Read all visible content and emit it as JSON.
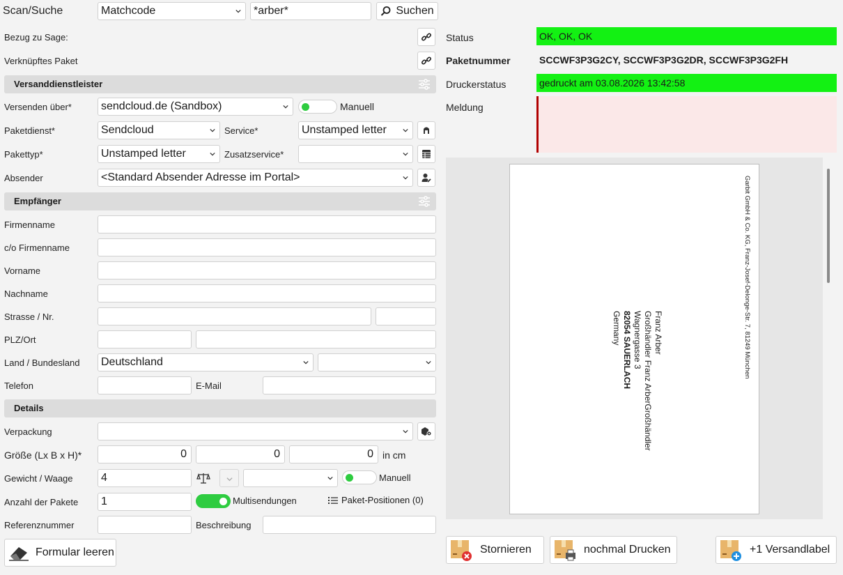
{
  "scan": {
    "label": "Scan/Suche",
    "mode": "Matchcode",
    "query": "*arber*",
    "search_button": "Suchen"
  },
  "refs": {
    "sage_label": "Bezug zu Sage:",
    "paket_label": "Verknüpftes Paket"
  },
  "versand": {
    "section_title": "Versanddienstleister",
    "versenden_label": "Versenden über*",
    "versenden_value": "sendcloud.de (Sandbox)",
    "manuell_label": "Manuell",
    "paketdienst_label": "Paketdienst*",
    "paketdienst_value": "Sendcloud",
    "service_label": "Service*",
    "service_value": "Unstamped letter",
    "pakettyp_label": "Pakettyp*",
    "pakettyp_value": "Unstamped letter",
    "zusatz_label": "Zusatzservice*",
    "zusatz_value": "",
    "absender_label": "Absender",
    "absender_value": "<Standard Absender Adresse im Portal>"
  },
  "empfaenger": {
    "section_title": "Empfänger",
    "firmenname_label": "Firmenname",
    "co_label": "c/o Firmenname",
    "vorname_label": "Vorname",
    "nachname_label": "Nachname",
    "strasse_label": "Strasse / Nr.",
    "plz_label": "PLZ/Ort",
    "land_label": "Land / Bundesland",
    "land_value": "Deutschland",
    "bundesland_value": "",
    "telefon_label": "Telefon",
    "email_label": "E-Mail"
  },
  "details": {
    "section_title": "Details",
    "verpackung_label": "Verpackung",
    "groesse_label": "Größe (Lx B x H)*",
    "l": "0",
    "b": "0",
    "h": "0",
    "unit": "in cm",
    "gewicht_label": "Gewicht / Waage",
    "gewicht_value": "4",
    "waage_manuell_label": "Manuell",
    "anzahl_label": "Anzahl der Pakete",
    "anzahl_value": "1",
    "multi_label": "Multisendungen",
    "positionen_label": "Paket-Positionen (0)",
    "referenz_label": "Referenznummer",
    "beschreibung_label": "Beschreibung"
  },
  "clear_button": "Formular leeren",
  "status": {
    "status_label": "Status",
    "status_value": "OK, OK, OK",
    "paketnummer_label": "Paketnummer",
    "paketnummer_value": "SCCWF3P3G2CY, SCCWF3P3G2DR, SCCWF3P3G2FH",
    "drucker_label": "Druckerstatus",
    "drucker_value": "gedruckt am 03.08.2026 13:42:58",
    "meldung_label": "Meldung"
  },
  "label_preview": {
    "sender_line": "Garbit GmbH & Co. KG, Franz-Josef-Delonge-Str. 7, 81249 München",
    "lines": [
      "Franz Arber",
      "Großhändler Franz ArberGroßhändler",
      "Wagnergasse 3",
      "82054 SAUERLACH",
      "Germany"
    ]
  },
  "actions": {
    "stornieren": "Stornieren",
    "nochmal": "nochmal Drucken",
    "versandlabel": "+1 Versandlabel"
  },
  "colors": {
    "ok_green": "#13f113",
    "meldung_bg": "#fbe8e8",
    "meldung_border": "#b00000"
  }
}
